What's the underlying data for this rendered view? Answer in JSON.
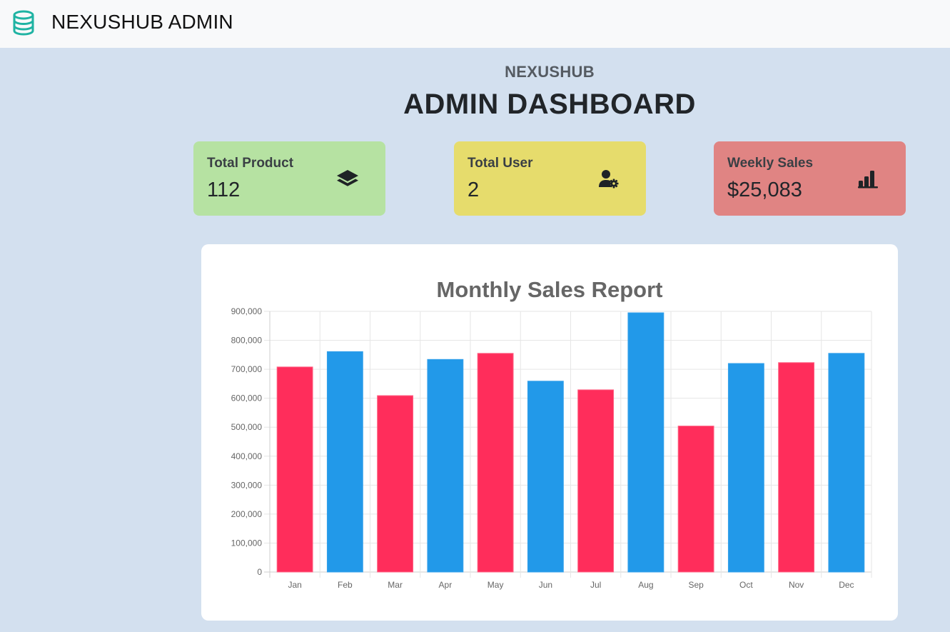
{
  "navbar": {
    "brand_icon": "database-icon",
    "title": "NEXUSHUB ADMIN"
  },
  "header": {
    "subtitle": "NEXUSHUB",
    "title": "ADMIN DASHBOARD"
  },
  "cards": {
    "product": {
      "label": "Total Product",
      "value": "112",
      "icon": "layers-icon",
      "color": "#b6e2a2"
    },
    "user": {
      "label": "Total User",
      "value": "2",
      "icon": "user-gear-icon",
      "color": "#e6dc6c"
    },
    "sales": {
      "label": "Weekly Sales",
      "value": "$25,083",
      "icon": "bar-chart-icon",
      "color": "#e08483"
    }
  },
  "chart_data": {
    "type": "bar",
    "title": "Monthly Sales Report",
    "categories": [
      "Jan",
      "Feb",
      "Mar",
      "Apr",
      "May",
      "Jun",
      "Jul",
      "Aug",
      "Sep",
      "Oct",
      "Nov",
      "Dec"
    ],
    "values": [
      708000,
      761000,
      609000,
      734000,
      755000,
      659000,
      629000,
      895000,
      504000,
      720000,
      723000,
      755000
    ],
    "bar_colors": [
      "#ff2d5b",
      "#2299e9",
      "#ff2d5b",
      "#2299e9",
      "#ff2d5b",
      "#2299e9",
      "#ff2d5b",
      "#2299e9",
      "#ff2d5b",
      "#2299e9",
      "#ff2d5b",
      "#2299e9"
    ],
    "ylim": [
      0,
      900000
    ],
    "yticks": [
      "0",
      "100,000",
      "200,000",
      "300,000",
      "400,000",
      "500,000",
      "600,000",
      "700,000",
      "800,000",
      "900,000"
    ],
    "grid": true,
    "legend": false
  }
}
